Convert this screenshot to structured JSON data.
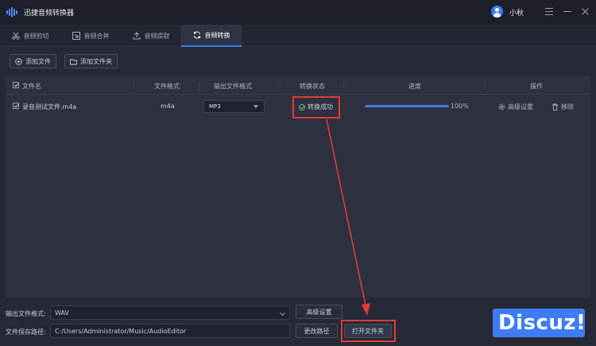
{
  "app": {
    "title": "迅捷音频转换器",
    "username": "小秋"
  },
  "tabs": [
    {
      "label": "音频剪切",
      "icon": "scissors-icon",
      "active": false
    },
    {
      "label": "音频合并",
      "icon": "merge-icon",
      "active": false
    },
    {
      "label": "音频提取",
      "icon": "extract-icon",
      "active": false
    },
    {
      "label": "音频转换",
      "icon": "convert-icon",
      "active": true
    }
  ],
  "toolbar": {
    "add_file": "添加文件",
    "add_folder": "添加文件夹"
  },
  "table": {
    "headers": {
      "name": "文件名",
      "format": "文件格式",
      "output_format": "输出文件格式",
      "status": "转换状态",
      "progress": "进度",
      "actions": "操作"
    },
    "rows": [
      {
        "name": "录音测试文件.m4a",
        "format": "m4a",
        "output_format": "MP3",
        "status": "转换成功",
        "progress_fraction": 1.0,
        "progress_text": "100%",
        "advanced": "高级设置",
        "remove": "移除"
      }
    ]
  },
  "bottom": {
    "output_format_label": "输出文件格式:",
    "output_format_value": "WAV",
    "advanced_button": "高级设置",
    "save_path_label": "文件保存路径:",
    "save_path_value": "C:/Users/Administrator/Music/AudioEditor",
    "change_path_button": "更改路径",
    "open_folder_button": "打开文件夹"
  },
  "watermark": "Discuz!",
  "colors": {
    "accent": "#3d7cf4",
    "success": "#5ac46a",
    "annotation": "#e23b3b",
    "background": "#262a37"
  }
}
